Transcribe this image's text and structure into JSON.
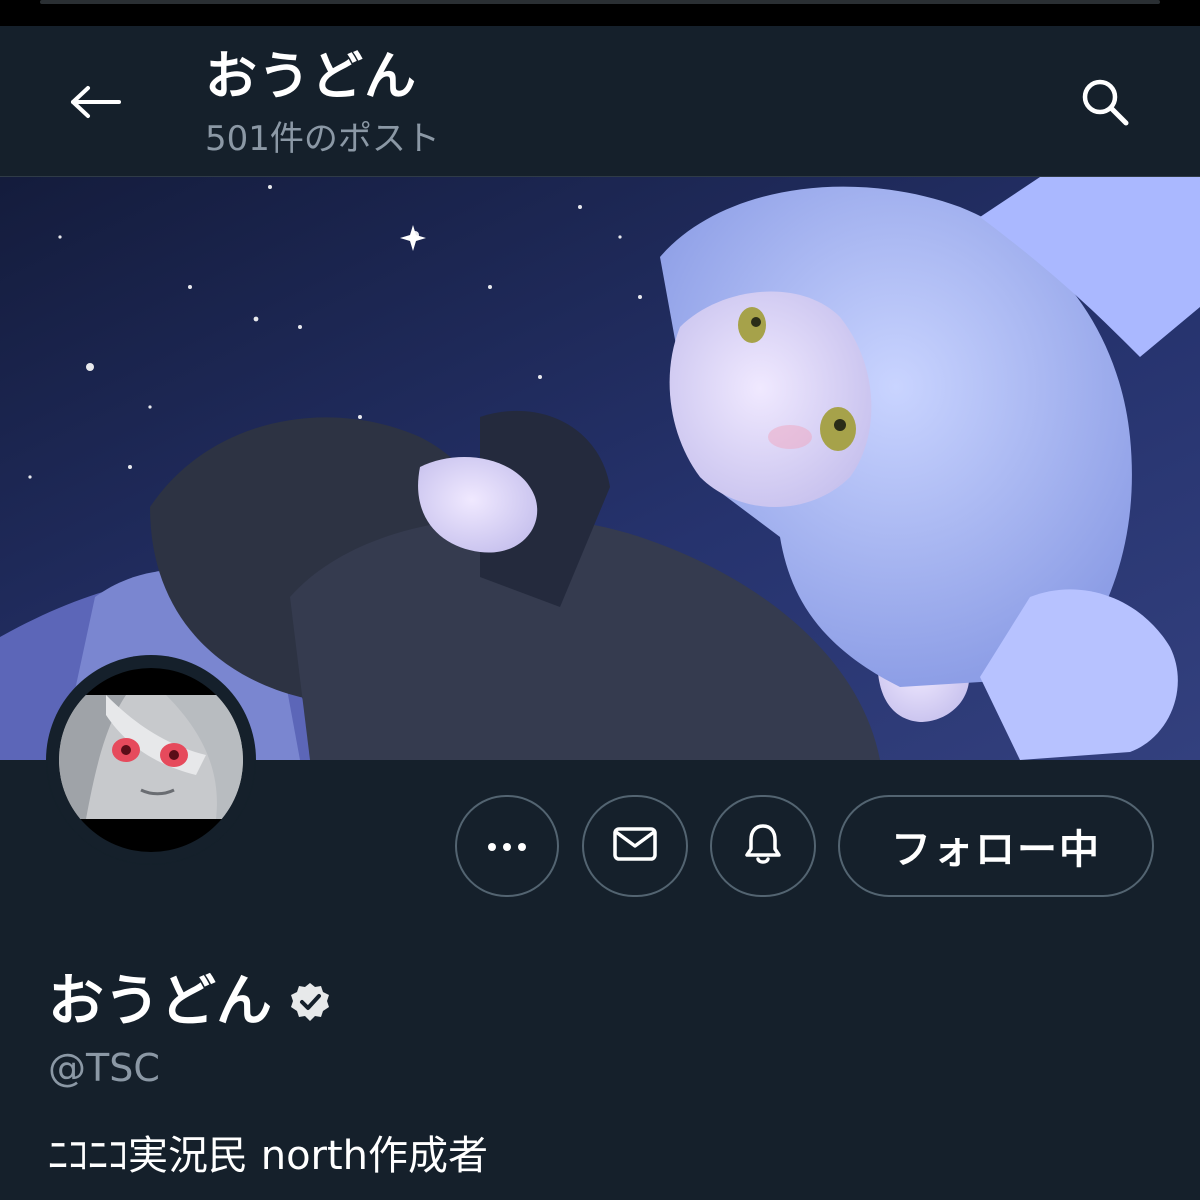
{
  "header": {
    "back_icon": "arrow-left-icon",
    "title": "おうどん",
    "post_count": "501件のポスト",
    "search_icon": "search-icon"
  },
  "banner": {
    "description": "anime-style header artwork"
  },
  "actions": {
    "more_icon": "more-dots-icon",
    "message_icon": "mail-icon",
    "notify_icon": "bell-icon",
    "follow_label": "フォロー中"
  },
  "profile": {
    "name": "おうどん",
    "verified_icon": "verified-badge-icon",
    "handle": "@TSC",
    "bio": "ﾆｺﾆｺ実況民 north作成者"
  },
  "colors": {
    "background": "#15202b",
    "text_primary": "#ffffff",
    "text_secondary": "#8b98a5",
    "border": "#536471"
  }
}
